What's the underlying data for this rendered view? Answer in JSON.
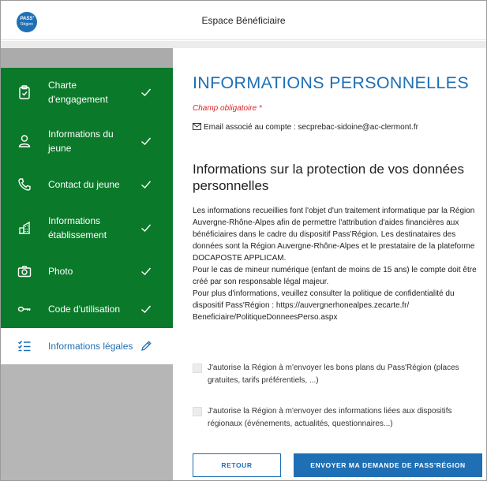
{
  "header": {
    "logo_line1": "PASS'",
    "logo_line2": "Région",
    "title": "Espace Bénéficiaire"
  },
  "sidebar": {
    "items": [
      {
        "label": "Charte d'engagement",
        "icon": "clipboard-icon",
        "status": "check-icon"
      },
      {
        "label": "Informations du jeune",
        "icon": "person-icon",
        "status": "check-icon"
      },
      {
        "label": "Contact du jeune",
        "icon": "phone-icon",
        "status": "check-icon"
      },
      {
        "label": "Informations établissement",
        "icon": "building-icon",
        "status": "check-icon"
      },
      {
        "label": "Photo",
        "icon": "camera-icon",
        "status": "check-icon"
      },
      {
        "label": "Code d'utilisation",
        "icon": "key-icon",
        "status": "check-icon"
      },
      {
        "label": "Informations légales",
        "icon": "list-icon",
        "status": "pencil-icon"
      }
    ]
  },
  "main": {
    "title": "INFORMATIONS PERSONNELLES",
    "required_note": "Champ obligatoire *",
    "email_line": "Email associé au compte : secprebac-sidoine@ac-clermont.fr",
    "section_title": "Informations sur la protection de vos données personnelles",
    "paragraph1": "Les informations recueillies font l'objet d'un traitement informatique par la Région Auvergne-Rhône-Alpes afin de permettre l'attribution d'aides financières aux bénéficiaires dans le cadre du dispositif Pass'Région. Les destinataires des données sont la Région Auvergne-Rhône-Alpes et le prestataire de la plateforme DOCAPOSTE APPLICAM.",
    "paragraph2": "Pour le cas de mineur numérique (enfant de moins de 15 ans) le compte doit être créé par son responsable légal majeur.",
    "paragraph3": "Pour plus d'informations, veuillez consulter la politique de confidentialité du dispositif Pass'Région : https://auvergnerhonealpes.zecarte.fr/ Beneficiaire/PolitiqueDonneesPerso.aspx",
    "consent1": "J'autorise la Région à m'envoyer les bons plans du Pass'Région (places gratuites, tarifs préférentiels, ...)",
    "consent2": "J'autorise la Région à m'envoyer des informations liées aux dispositifs régionaux (événements, actualités, questionnaires...)",
    "back_label": "RETOUR",
    "submit_label": "ENVOYER MA DEMANDE DE PASS'RÉGION"
  },
  "colors": {
    "brand_blue": "#1f6fb5",
    "nav_green": "#0a7a2a",
    "required_red": "#d9262a"
  }
}
